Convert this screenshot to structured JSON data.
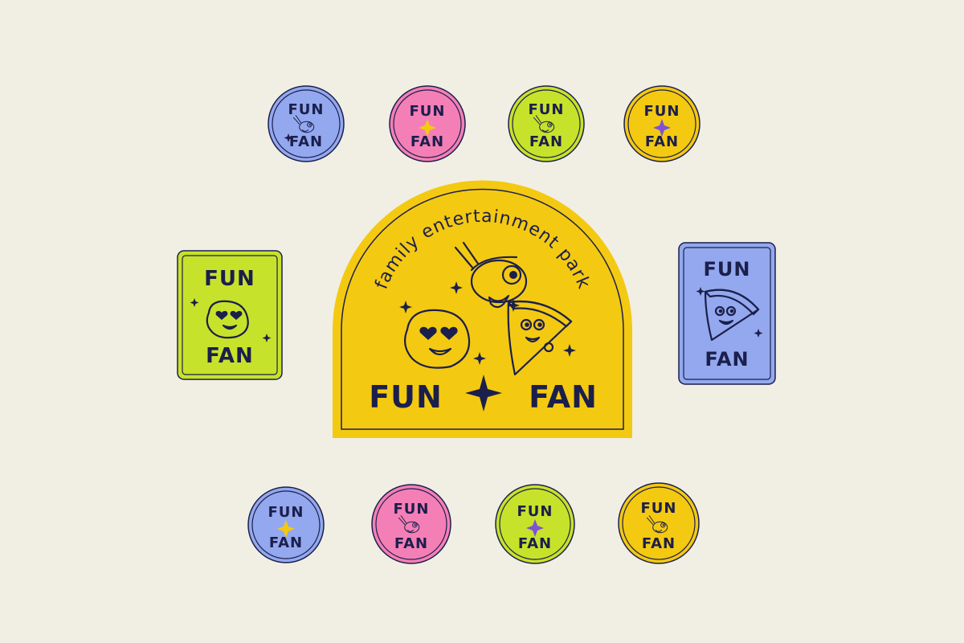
{
  "brand": {
    "word_top": "FUN",
    "word_bottom": "FAN",
    "tagline": "family entertainment park"
  },
  "colors": {
    "background": "#f1efe4",
    "ink": "#1b1f4b",
    "blue": "#93a8ee",
    "pink": "#f47fb6",
    "lime": "#c7e22a",
    "yellow": "#f4c911",
    "purple": "#7d52d6"
  },
  "stickers": {
    "top_row": [
      {
        "fill": "blue",
        "art": "mascot-fish-icon"
      },
      {
        "fill": "pink",
        "art": "sparkle-icon",
        "accent": "yellow"
      },
      {
        "fill": "lime",
        "art": "mascot-fish-icon"
      },
      {
        "fill": "yellow",
        "art": "sparkle-icon",
        "accent": "purple"
      }
    ],
    "bottom_row": [
      {
        "fill": "blue",
        "art": "sparkle-icon",
        "accent": "yellow"
      },
      {
        "fill": "pink",
        "art": "mascot-fish-icon"
      },
      {
        "fill": "lime",
        "art": "sparkle-icon",
        "accent": "purple"
      },
      {
        "fill": "yellow",
        "art": "mascot-fish-icon"
      }
    ],
    "left_card": {
      "fill": "lime",
      "art": "mascot-blob-icon"
    },
    "right_card": {
      "fill": "blue",
      "art": "mascot-pizza-icon"
    },
    "center_badge": {
      "fill": "yellow",
      "art": [
        "mascot-fish-icon",
        "mascot-blob-icon",
        "mascot-pizza-icon"
      ]
    }
  }
}
